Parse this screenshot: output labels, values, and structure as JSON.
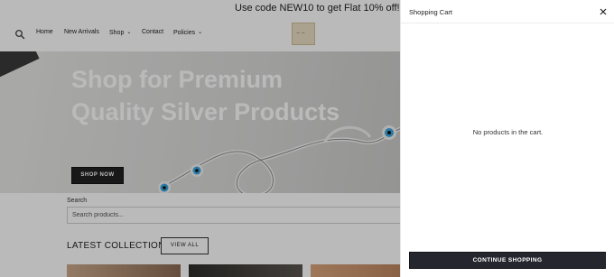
{
  "promo": {
    "text": "Use code NEW10 to get Flat 10% off!"
  },
  "nav": {
    "items": [
      {
        "label": "Home"
      },
      {
        "label": "New Arrivals"
      },
      {
        "label": "Shop"
      },
      {
        "label": "Contact"
      },
      {
        "label": "Policies"
      }
    ]
  },
  "hero": {
    "title": "Shop for Premium Quality Silver Products",
    "button_label": "SHOP NOW"
  },
  "search": {
    "label": "Search",
    "placeholder": "Search products..."
  },
  "collection": {
    "title": "LATEST COLLECTION",
    "view_all_label": "VIEW ALL"
  },
  "cart": {
    "title": "Shopping Cart",
    "empty_message": "No products in the cart.",
    "continue_label": "CONTINUE SHOPPING"
  },
  "icons": {
    "search": "search-icon",
    "close": "close-icon",
    "caret": "chevron-down-icon"
  },
  "colors": {
    "overlay": "#000000",
    "button_dark": "#26262e",
    "hero_text": "#ffffff"
  }
}
